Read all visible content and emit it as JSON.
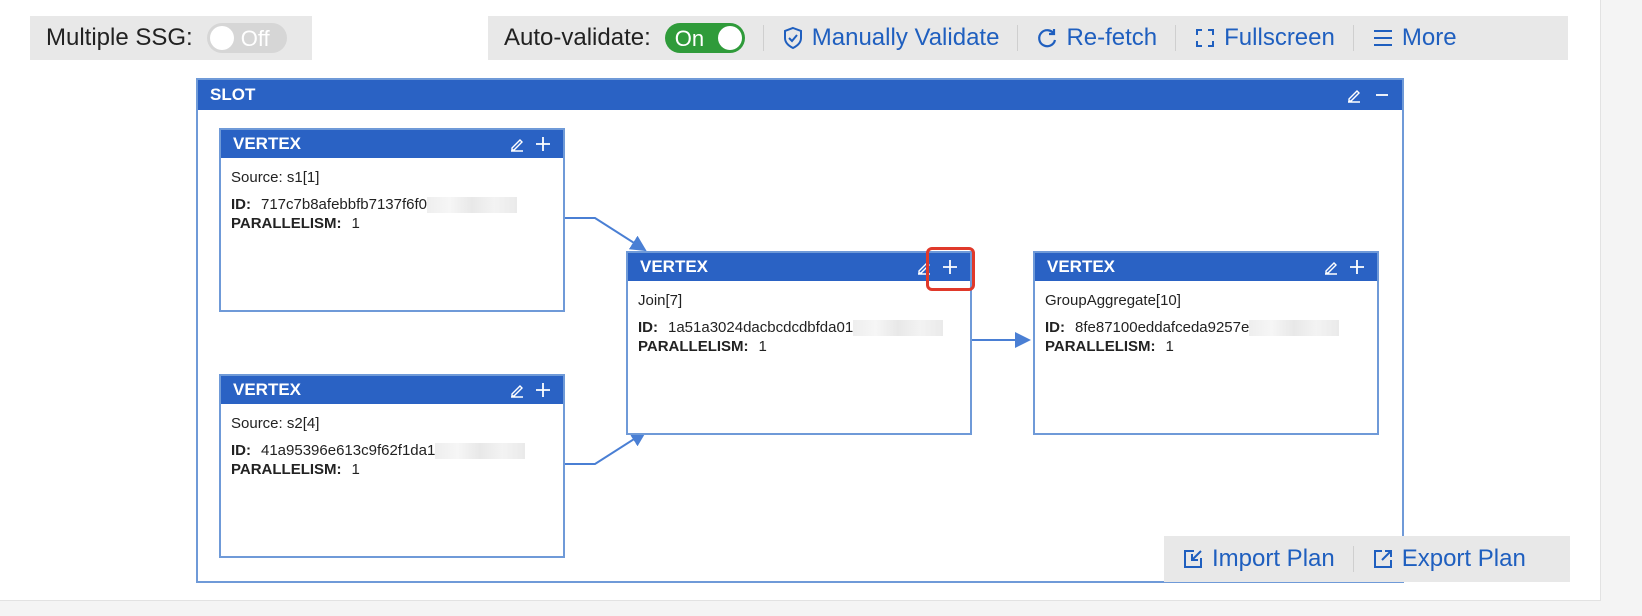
{
  "ssg": {
    "label": "Multiple SSG:",
    "toggle": "Off"
  },
  "toolbar": {
    "auto_validate_label": "Auto-validate:",
    "auto_validate_toggle": "On",
    "manually_validate": "Manually Validate",
    "refetch": "Re-fetch",
    "fullscreen": "Fullscreen",
    "more": "More"
  },
  "slot": {
    "title": "SLOT"
  },
  "vertices": [
    {
      "title": "VERTEX",
      "name": "Source: s1[1]",
      "id_label": "ID:",
      "id": "717c7b8afebbfb7137f6f0",
      "parallelism_label": "PARALLELISM:",
      "parallelism": "1"
    },
    {
      "title": "VERTEX",
      "name": "Source: s2[4]",
      "id_label": "ID:",
      "id": "41a95396e613c9f62f1da1",
      "parallelism_label": "PARALLELISM:",
      "parallelism": "1"
    },
    {
      "title": "VERTEX",
      "name": "Join[7]",
      "id_label": "ID:",
      "id": "1a51a3024dacbcdcdbfda01",
      "parallelism_label": "PARALLELISM:",
      "parallelism": "1"
    },
    {
      "title": "VERTEX",
      "name": "GroupAggregate[10]",
      "id_label": "ID:",
      "id": "8fe87100eddafceda9257e",
      "parallelism_label": "PARALLELISM:",
      "parallelism": "1"
    }
  ],
  "plan": {
    "import": "Import Plan",
    "export": "Export Plan"
  },
  "colors": {
    "accent": "#2a62c4",
    "link": "#1f5fbf",
    "toggle_on": "#2f9b3a",
    "highlight": "#e0392a"
  }
}
